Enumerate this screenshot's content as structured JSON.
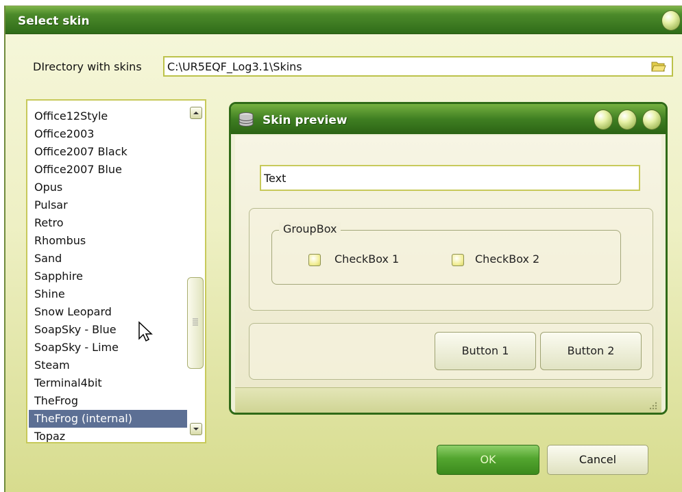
{
  "window": {
    "title": "Select skin"
  },
  "directory": {
    "label": "DIrectory with skins",
    "value": "C:\\UR5EQF_Log3.1\\Skins"
  },
  "skin_list": {
    "items": [
      "Office12Style",
      "Office2003",
      "Office2007 Black",
      "Office2007 Blue",
      "Opus",
      "Pulsar",
      "Retro",
      "Rhombus",
      "Sand",
      "Sapphire",
      "Shine",
      "Snow Leopard",
      "SoapSky - Blue",
      "SoapSky - Lime",
      "Steam",
      "Terminal4bit",
      "TheFrog",
      "TheFrog (internal)",
      "Topaz"
    ],
    "selected": "TheFrog (internal)"
  },
  "preview": {
    "title": "Skin preview",
    "text_value": "Text",
    "groupbox_label": "GroupBox",
    "checkbox1_label": "CheckBox 1",
    "checkbox2_label": "CheckBox 2",
    "button1_label": "Button 1",
    "button2_label": "Button 2"
  },
  "footer": {
    "ok_label": "OK",
    "cancel_label": "Cancel"
  },
  "colors": {
    "accent": "#3f7f22",
    "selection": "#5c6f94",
    "ok_green": "#53a52f"
  },
  "icons": {
    "folder": "folder-open-icon",
    "preview_title": "database-icon",
    "grip": "resize-grip-icon"
  }
}
